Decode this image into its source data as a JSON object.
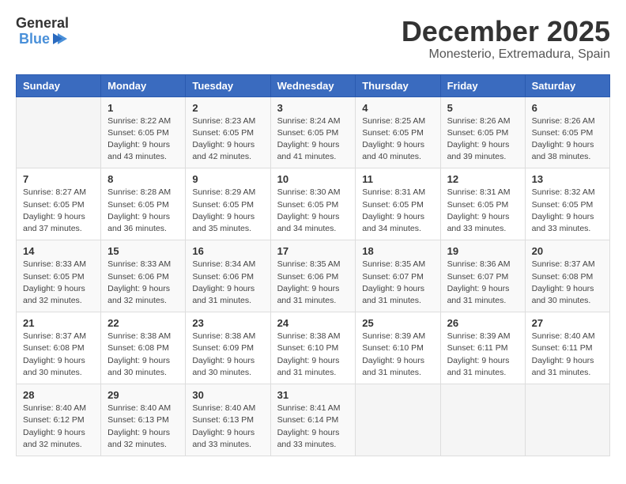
{
  "logo": {
    "general": "General",
    "blue": "Blue"
  },
  "title": {
    "month": "December 2025",
    "location": "Monesterio, Extremadura, Spain"
  },
  "headers": [
    "Sunday",
    "Monday",
    "Tuesday",
    "Wednesday",
    "Thursday",
    "Friday",
    "Saturday"
  ],
  "weeks": [
    [
      {
        "day": "",
        "sunrise": "",
        "sunset": "",
        "daylight": ""
      },
      {
        "day": "1",
        "sunrise": "Sunrise: 8:22 AM",
        "sunset": "Sunset: 6:05 PM",
        "daylight": "Daylight: 9 hours and 43 minutes."
      },
      {
        "day": "2",
        "sunrise": "Sunrise: 8:23 AM",
        "sunset": "Sunset: 6:05 PM",
        "daylight": "Daylight: 9 hours and 42 minutes."
      },
      {
        "day": "3",
        "sunrise": "Sunrise: 8:24 AM",
        "sunset": "Sunset: 6:05 PM",
        "daylight": "Daylight: 9 hours and 41 minutes."
      },
      {
        "day": "4",
        "sunrise": "Sunrise: 8:25 AM",
        "sunset": "Sunset: 6:05 PM",
        "daylight": "Daylight: 9 hours and 40 minutes."
      },
      {
        "day": "5",
        "sunrise": "Sunrise: 8:26 AM",
        "sunset": "Sunset: 6:05 PM",
        "daylight": "Daylight: 9 hours and 39 minutes."
      },
      {
        "day": "6",
        "sunrise": "Sunrise: 8:26 AM",
        "sunset": "Sunset: 6:05 PM",
        "daylight": "Daylight: 9 hours and 38 minutes."
      }
    ],
    [
      {
        "day": "7",
        "sunrise": "Sunrise: 8:27 AM",
        "sunset": "Sunset: 6:05 PM",
        "daylight": "Daylight: 9 hours and 37 minutes."
      },
      {
        "day": "8",
        "sunrise": "Sunrise: 8:28 AM",
        "sunset": "Sunset: 6:05 PM",
        "daylight": "Daylight: 9 hours and 36 minutes."
      },
      {
        "day": "9",
        "sunrise": "Sunrise: 8:29 AM",
        "sunset": "Sunset: 6:05 PM",
        "daylight": "Daylight: 9 hours and 35 minutes."
      },
      {
        "day": "10",
        "sunrise": "Sunrise: 8:30 AM",
        "sunset": "Sunset: 6:05 PM",
        "daylight": "Daylight: 9 hours and 34 minutes."
      },
      {
        "day": "11",
        "sunrise": "Sunrise: 8:31 AM",
        "sunset": "Sunset: 6:05 PM",
        "daylight": "Daylight: 9 hours and 34 minutes."
      },
      {
        "day": "12",
        "sunrise": "Sunrise: 8:31 AM",
        "sunset": "Sunset: 6:05 PM",
        "daylight": "Daylight: 9 hours and 33 minutes."
      },
      {
        "day": "13",
        "sunrise": "Sunrise: 8:32 AM",
        "sunset": "Sunset: 6:05 PM",
        "daylight": "Daylight: 9 hours and 33 minutes."
      }
    ],
    [
      {
        "day": "14",
        "sunrise": "Sunrise: 8:33 AM",
        "sunset": "Sunset: 6:05 PM",
        "daylight": "Daylight: 9 hours and 32 minutes."
      },
      {
        "day": "15",
        "sunrise": "Sunrise: 8:33 AM",
        "sunset": "Sunset: 6:06 PM",
        "daylight": "Daylight: 9 hours and 32 minutes."
      },
      {
        "day": "16",
        "sunrise": "Sunrise: 8:34 AM",
        "sunset": "Sunset: 6:06 PM",
        "daylight": "Daylight: 9 hours and 31 minutes."
      },
      {
        "day": "17",
        "sunrise": "Sunrise: 8:35 AM",
        "sunset": "Sunset: 6:06 PM",
        "daylight": "Daylight: 9 hours and 31 minutes."
      },
      {
        "day": "18",
        "sunrise": "Sunrise: 8:35 AM",
        "sunset": "Sunset: 6:07 PM",
        "daylight": "Daylight: 9 hours and 31 minutes."
      },
      {
        "day": "19",
        "sunrise": "Sunrise: 8:36 AM",
        "sunset": "Sunset: 6:07 PM",
        "daylight": "Daylight: 9 hours and 31 minutes."
      },
      {
        "day": "20",
        "sunrise": "Sunrise: 8:37 AM",
        "sunset": "Sunset: 6:08 PM",
        "daylight": "Daylight: 9 hours and 30 minutes."
      }
    ],
    [
      {
        "day": "21",
        "sunrise": "Sunrise: 8:37 AM",
        "sunset": "Sunset: 6:08 PM",
        "daylight": "Daylight: 9 hours and 30 minutes."
      },
      {
        "day": "22",
        "sunrise": "Sunrise: 8:38 AM",
        "sunset": "Sunset: 6:08 PM",
        "daylight": "Daylight: 9 hours and 30 minutes."
      },
      {
        "day": "23",
        "sunrise": "Sunrise: 8:38 AM",
        "sunset": "Sunset: 6:09 PM",
        "daylight": "Daylight: 9 hours and 30 minutes."
      },
      {
        "day": "24",
        "sunrise": "Sunrise: 8:38 AM",
        "sunset": "Sunset: 6:10 PM",
        "daylight": "Daylight: 9 hours and 31 minutes."
      },
      {
        "day": "25",
        "sunrise": "Sunrise: 8:39 AM",
        "sunset": "Sunset: 6:10 PM",
        "daylight": "Daylight: 9 hours and 31 minutes."
      },
      {
        "day": "26",
        "sunrise": "Sunrise: 8:39 AM",
        "sunset": "Sunset: 6:11 PM",
        "daylight": "Daylight: 9 hours and 31 minutes."
      },
      {
        "day": "27",
        "sunrise": "Sunrise: 8:40 AM",
        "sunset": "Sunset: 6:11 PM",
        "daylight": "Daylight: 9 hours and 31 minutes."
      }
    ],
    [
      {
        "day": "28",
        "sunrise": "Sunrise: 8:40 AM",
        "sunset": "Sunset: 6:12 PM",
        "daylight": "Daylight: 9 hours and 32 minutes."
      },
      {
        "day": "29",
        "sunrise": "Sunrise: 8:40 AM",
        "sunset": "Sunset: 6:13 PM",
        "daylight": "Daylight: 9 hours and 32 minutes."
      },
      {
        "day": "30",
        "sunrise": "Sunrise: 8:40 AM",
        "sunset": "Sunset: 6:13 PM",
        "daylight": "Daylight: 9 hours and 33 minutes."
      },
      {
        "day": "31",
        "sunrise": "Sunrise: 8:41 AM",
        "sunset": "Sunset: 6:14 PM",
        "daylight": "Daylight: 9 hours and 33 minutes."
      },
      {
        "day": "",
        "sunrise": "",
        "sunset": "",
        "daylight": ""
      },
      {
        "day": "",
        "sunrise": "",
        "sunset": "",
        "daylight": ""
      },
      {
        "day": "",
        "sunrise": "",
        "sunset": "",
        "daylight": ""
      }
    ]
  ]
}
